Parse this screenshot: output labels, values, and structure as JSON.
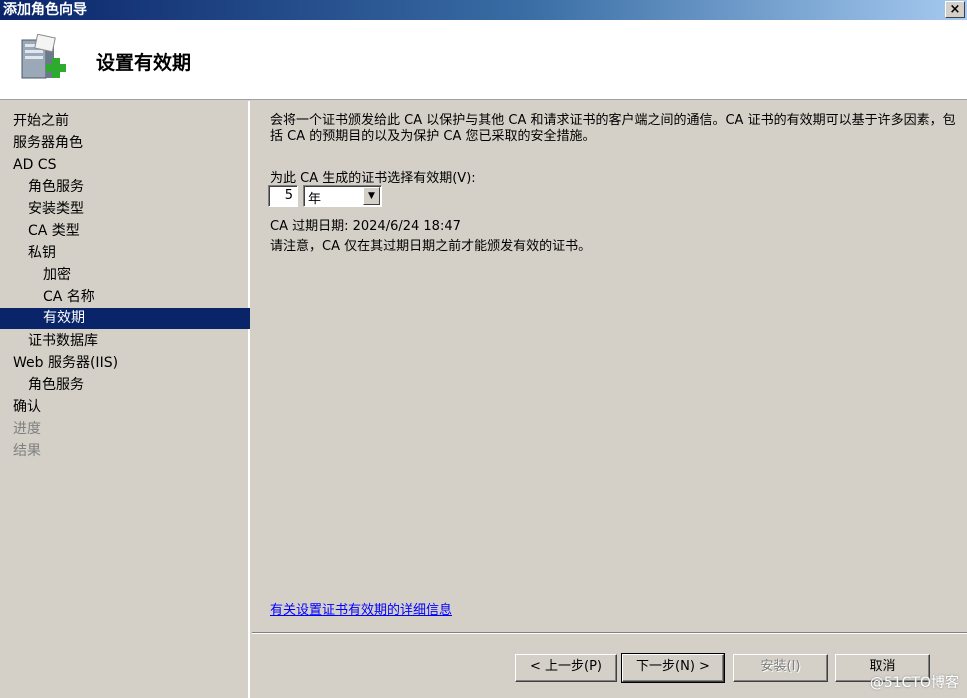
{
  "window": {
    "title": "添加角色向导",
    "close_label": "×"
  },
  "header": {
    "title": "设置有效期"
  },
  "sidebar": {
    "items": [
      {
        "label": "开始之前",
        "indent": 0,
        "state": "normal"
      },
      {
        "label": "服务器角色",
        "indent": 0,
        "state": "normal"
      },
      {
        "label": "AD CS",
        "indent": 0,
        "state": "normal"
      },
      {
        "label": "角色服务",
        "indent": 1,
        "state": "normal"
      },
      {
        "label": "安装类型",
        "indent": 1,
        "state": "normal"
      },
      {
        "label": "CA 类型",
        "indent": 1,
        "state": "normal"
      },
      {
        "label": "私钥",
        "indent": 1,
        "state": "normal"
      },
      {
        "label": "加密",
        "indent": 2,
        "state": "normal"
      },
      {
        "label": "CA 名称",
        "indent": 2,
        "state": "normal"
      },
      {
        "label": "有效期",
        "indent": 2,
        "state": "selected"
      },
      {
        "label": "证书数据库",
        "indent": 1,
        "state": "normal"
      },
      {
        "label": "Web 服务器(IIS)",
        "indent": 0,
        "state": "normal"
      },
      {
        "label": "角色服务",
        "indent": 1,
        "state": "normal"
      },
      {
        "label": "确认",
        "indent": 0,
        "state": "normal"
      },
      {
        "label": "进度",
        "indent": 0,
        "state": "disabled"
      },
      {
        "label": "结果",
        "indent": 0,
        "state": "disabled"
      }
    ]
  },
  "main": {
    "description": "会将一个证书颁发给此 CA 以保护与其他 CA 和请求证书的客户端之间的通信。CA 证书的有效期可以基于许多因素，包括 CA 的预期目的以及为保护 CA 您已采取的安全措施。",
    "period_label": "为此 CA 生成的证书选择有效期(V):",
    "period_value": "5",
    "period_unit": "年",
    "expiry_text": "CA 过期日期: 2024/6/24 18:47",
    "note": "请注意，CA 仅在其过期日期之前才能颁发有效的证书。",
    "more_info_link": "有关设置证书有效期的详细信息"
  },
  "buttons": {
    "back": "< 上一步(P)",
    "next": "下一步(N) >",
    "install": "安装(I)",
    "cancel": "取消"
  },
  "watermark": "@51CTO博客"
}
